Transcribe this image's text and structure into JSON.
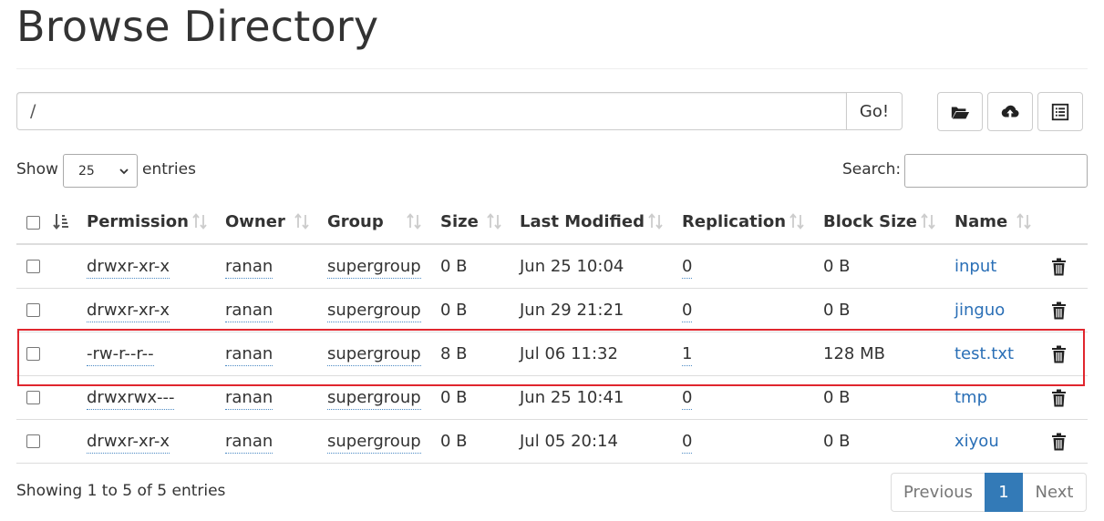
{
  "page": {
    "title": "Browse Directory"
  },
  "path_bar": {
    "value": "/",
    "go_label": "Go!"
  },
  "toolbar": {
    "icons": [
      "folder-open-icon",
      "cloud-upload-icon",
      "list-alt-icon"
    ]
  },
  "length": {
    "show_label": "Show",
    "selected": "25",
    "entries_label": "entries"
  },
  "search": {
    "label": "Search:",
    "value": ""
  },
  "table": {
    "columns": [
      "Permission",
      "Owner",
      "Group",
      "Size",
      "Last Modified",
      "Replication",
      "Block Size",
      "Name"
    ],
    "rows": [
      {
        "permission": "drwxr-xr-x",
        "owner": "ranan",
        "group": "supergroup",
        "size": "0 B",
        "modified": "Jun 25 10:04",
        "replication": "0",
        "block_size": "0 B",
        "name": "input"
      },
      {
        "permission": "drwxr-xr-x",
        "owner": "ranan",
        "group": "supergroup",
        "size": "0 B",
        "modified": "Jun 29 21:21",
        "replication": "0",
        "block_size": "0 B",
        "name": "jinguo"
      },
      {
        "permission": "-rw-r--r--",
        "owner": "ranan",
        "group": "supergroup",
        "size": "8 B",
        "modified": "Jul 06 11:32",
        "replication": "1",
        "block_size": "128 MB",
        "name": "test.txt"
      },
      {
        "permission": "drwxrwx---",
        "owner": "ranan",
        "group": "supergroup",
        "size": "0 B",
        "modified": "Jun 25 10:41",
        "replication": "0",
        "block_size": "0 B",
        "name": "tmp"
      },
      {
        "permission": "drwxr-xr-x",
        "owner": "ranan",
        "group": "supergroup",
        "size": "0 B",
        "modified": "Jul 05 20:14",
        "replication": "0",
        "block_size": "0 B",
        "name": "xiyou"
      }
    ],
    "highlighted_row": 2,
    "highlight_color": "#e0262e"
  },
  "footer": {
    "info": "Showing 1 to 5 of 5 entries",
    "prev_label": "Previous",
    "current_page": "1",
    "next_label": "Next"
  },
  "colors": {
    "link": "#2a6fb6",
    "pager_active": "#337ab7"
  }
}
